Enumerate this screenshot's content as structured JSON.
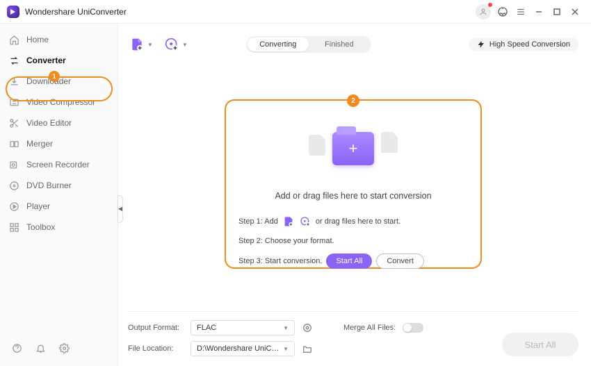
{
  "app": {
    "title": "Wondershare UniConverter"
  },
  "sidebar": {
    "items": [
      {
        "label": "Home"
      },
      {
        "label": "Converter"
      },
      {
        "label": "Downloader"
      },
      {
        "label": "Video Compressor"
      },
      {
        "label": "Video Editor"
      },
      {
        "label": "Merger"
      },
      {
        "label": "Screen Recorder"
      },
      {
        "label": "DVD Burner"
      },
      {
        "label": "Player"
      },
      {
        "label": "Toolbox"
      }
    ],
    "badge1": "1"
  },
  "tabs": {
    "converting": "Converting",
    "finished": "Finished"
  },
  "hsc": "High Speed Conversion",
  "dropzone": {
    "badge2": "2",
    "headline": "Add or drag files here to start conversion",
    "step1_prefix": "Step 1: Add",
    "step1_suffix": "or drag files here to start.",
    "step2": "Step 2: Choose your format.",
    "step3": "Step 3: Start conversion.",
    "startall": "Start All",
    "convert": "Convert"
  },
  "bottom": {
    "outputFormatLabel": "Output Format:",
    "outputFormatValue": "FLAC",
    "mergeLabel": "Merge All Files:",
    "fileLocationLabel": "File Location:",
    "fileLocationValue": "D:\\Wondershare UniConverter",
    "startAllDisabled": "Start All"
  },
  "icons": {
    "addfile": "add-file-icon",
    "adddvd": "add-dvd-icon"
  },
  "colors": {
    "accent": "#8a63f7",
    "highlight": "#f28a1e"
  }
}
